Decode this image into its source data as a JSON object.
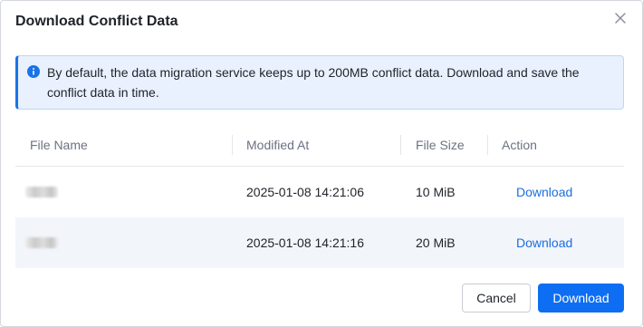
{
  "dialog": {
    "title": "Download Conflict Data"
  },
  "notice": {
    "text": "By default, the data migration service keeps up to 200MB conflict data. Download and save the conflict data in time.",
    "icon": "info-icon",
    "accent_color": "#1a73e8"
  },
  "table": {
    "headers": [
      "File Name",
      "Modified At",
      "File Size",
      "Action"
    ],
    "rows": [
      {
        "file_name": "",
        "modified_at": "2025-01-08 14:21:06",
        "file_size": "10 MiB",
        "action": "Download"
      },
      {
        "file_name": "",
        "modified_at": "2025-01-08 14:21:16",
        "file_size": "20 MiB",
        "action": "Download"
      }
    ]
  },
  "footer": {
    "cancel_label": "Cancel",
    "download_label": "Download",
    "primary_color": "#0d6ef3"
  }
}
